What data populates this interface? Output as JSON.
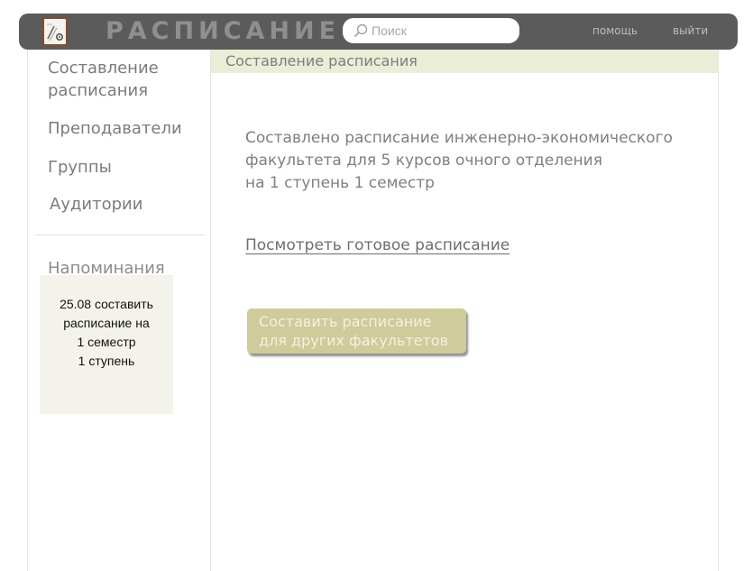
{
  "header": {
    "app_title": "РАСПИСАНИЕ",
    "search_placeholder": "Поиск",
    "help_label": "помощь",
    "logout_label": "выйти"
  },
  "sidebar": {
    "items": [
      {
        "label": "Составление расписания"
      },
      {
        "label": "Преподаватели"
      },
      {
        "label": "Группы"
      },
      {
        "label": "Аудитории"
      }
    ],
    "reminders_title": "Напоминания",
    "reminder_text": "25.08 составить\nрасписание на\n1 семестр\n1 ступень"
  },
  "main": {
    "section_title": "Составление расписания",
    "status_lines": [
      "Составлено расписание инженерно-экономического",
      "факультета для 5 курсов очного отделения",
      "на 1 ступень 1 семестр"
    ],
    "view_link": "Посмотреть готовое расписание",
    "compose_button_lines": [
      "Составить расписание",
      "для других факультетов"
    ]
  },
  "icons": {
    "logo": "schedule-document-icon",
    "search": "search-icon"
  },
  "colors": {
    "header_bg": "#5b5b5b",
    "section_header_bg": "#ebeed6",
    "button_bg": "#cfcb9a",
    "reminder_bg": "#f3f3ec",
    "logo_border": "#8a4a2a"
  }
}
